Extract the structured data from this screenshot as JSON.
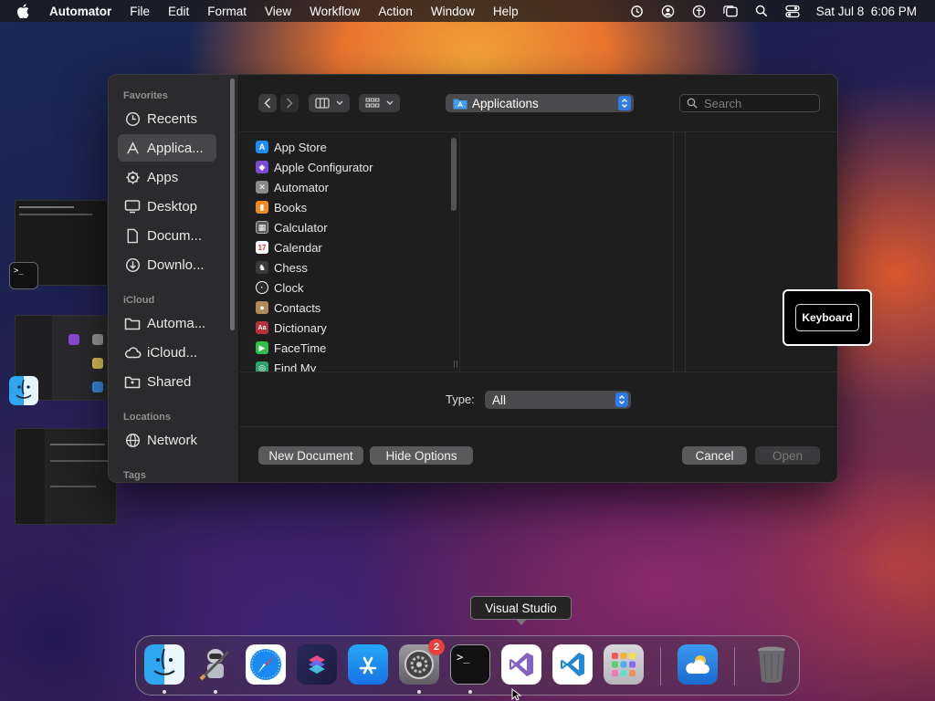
{
  "menubar": {
    "app_name": "Automator",
    "items": [
      "File",
      "Edit",
      "Format",
      "View",
      "Workflow",
      "Action",
      "Window",
      "Help"
    ],
    "datetime": "Sat Jul 8  6:06 PM"
  },
  "sidebar": {
    "favorites_heading": "Favorites",
    "favorites": [
      {
        "label": "Recents",
        "icon": "clock-icon"
      },
      {
        "label": "Applica...",
        "icon": "applications-icon",
        "selected": true
      },
      {
        "label": "Apps",
        "icon": "gear-folder-icon"
      },
      {
        "label": "Desktop",
        "icon": "desktop-icon"
      },
      {
        "label": "Docum...",
        "icon": "document-icon"
      },
      {
        "label": "Downlo...",
        "icon": "download-icon"
      }
    ],
    "icloud_heading": "iCloud",
    "icloud": [
      {
        "label": "Automa...",
        "icon": "folder-icon"
      },
      {
        "label": "iCloud...",
        "icon": "cloud-icon"
      },
      {
        "label": "Shared",
        "icon": "shared-folder-icon"
      }
    ],
    "locations_heading": "Locations",
    "locations": [
      {
        "label": "Network",
        "icon": "globe-icon"
      }
    ],
    "tags_heading": "Tags"
  },
  "toolbar": {
    "location": "Applications",
    "search_placeholder": "Search"
  },
  "apps": [
    {
      "name": "App Store",
      "color": "#1e8cf0"
    },
    {
      "name": "Apple Configurator",
      "color": "#7a4cd6"
    },
    {
      "name": "Automator",
      "color": "#8a8a8a"
    },
    {
      "name": "Books",
      "color": "#f08a24"
    },
    {
      "name": "Calculator",
      "color": "#5a5a5a"
    },
    {
      "name": "Calendar",
      "color": "#ffffff"
    },
    {
      "name": "Chess",
      "color": "#3a3a3a"
    },
    {
      "name": "Clock",
      "color": "#2a2a2a"
    },
    {
      "name": "Contacts",
      "color": "#b08a5a"
    },
    {
      "name": "Dictionary",
      "color": "#b5343a"
    },
    {
      "name": "FaceTime",
      "color": "#2fbf4a"
    },
    {
      "name": "Find My",
      "color": "#30a070"
    }
  ],
  "type_row": {
    "label": "Type:",
    "value": "All"
  },
  "buttons": {
    "new_document": "New Document",
    "hide_options": "Hide Options",
    "cancel": "Cancel",
    "open": "Open"
  },
  "keyboard_hud": "Keyboard",
  "dock": {
    "tooltip": "Visual Studio",
    "apps": [
      "Finder",
      "Automator",
      "Safari",
      "Shortcuts",
      "App Store",
      "System Settings",
      "Terminal",
      "Visual Studio",
      "Visual Studio Code",
      "Launchpad",
      "Weather",
      "Trash"
    ],
    "settings_badge": "2"
  }
}
